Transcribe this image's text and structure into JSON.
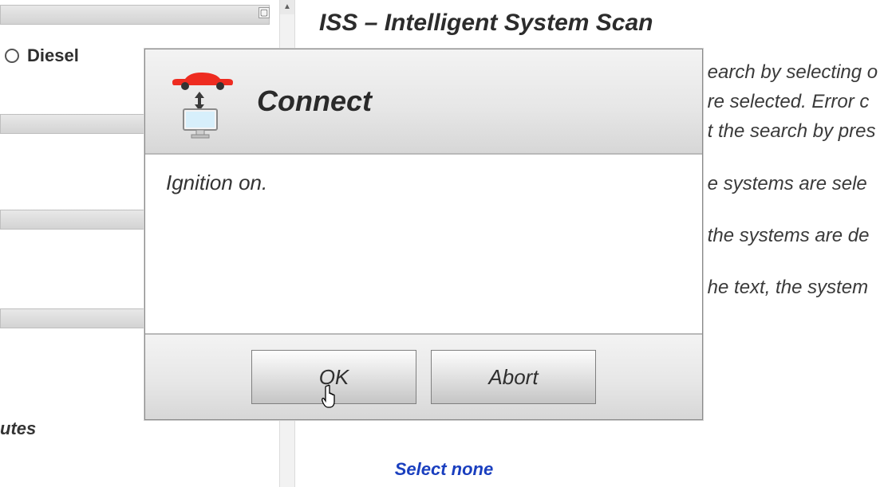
{
  "left": {
    "radio_label": "Diesel",
    "bottom_label_fragment": "utes"
  },
  "main": {
    "title": "ISS – Intelligent System Scan",
    "para1_line1": "earch by selecting o",
    "para1_line2": "re selected. Error c",
    "para1_line3": "t the search by pres",
    "para2": "e systems are sele",
    "para3": "the systems are de",
    "para4": "he text, the system",
    "select_none": "Select none"
  },
  "dialog": {
    "title": "Connect",
    "message": "Ignition on.",
    "ok_label": "OK",
    "abort_label": "Abort"
  }
}
